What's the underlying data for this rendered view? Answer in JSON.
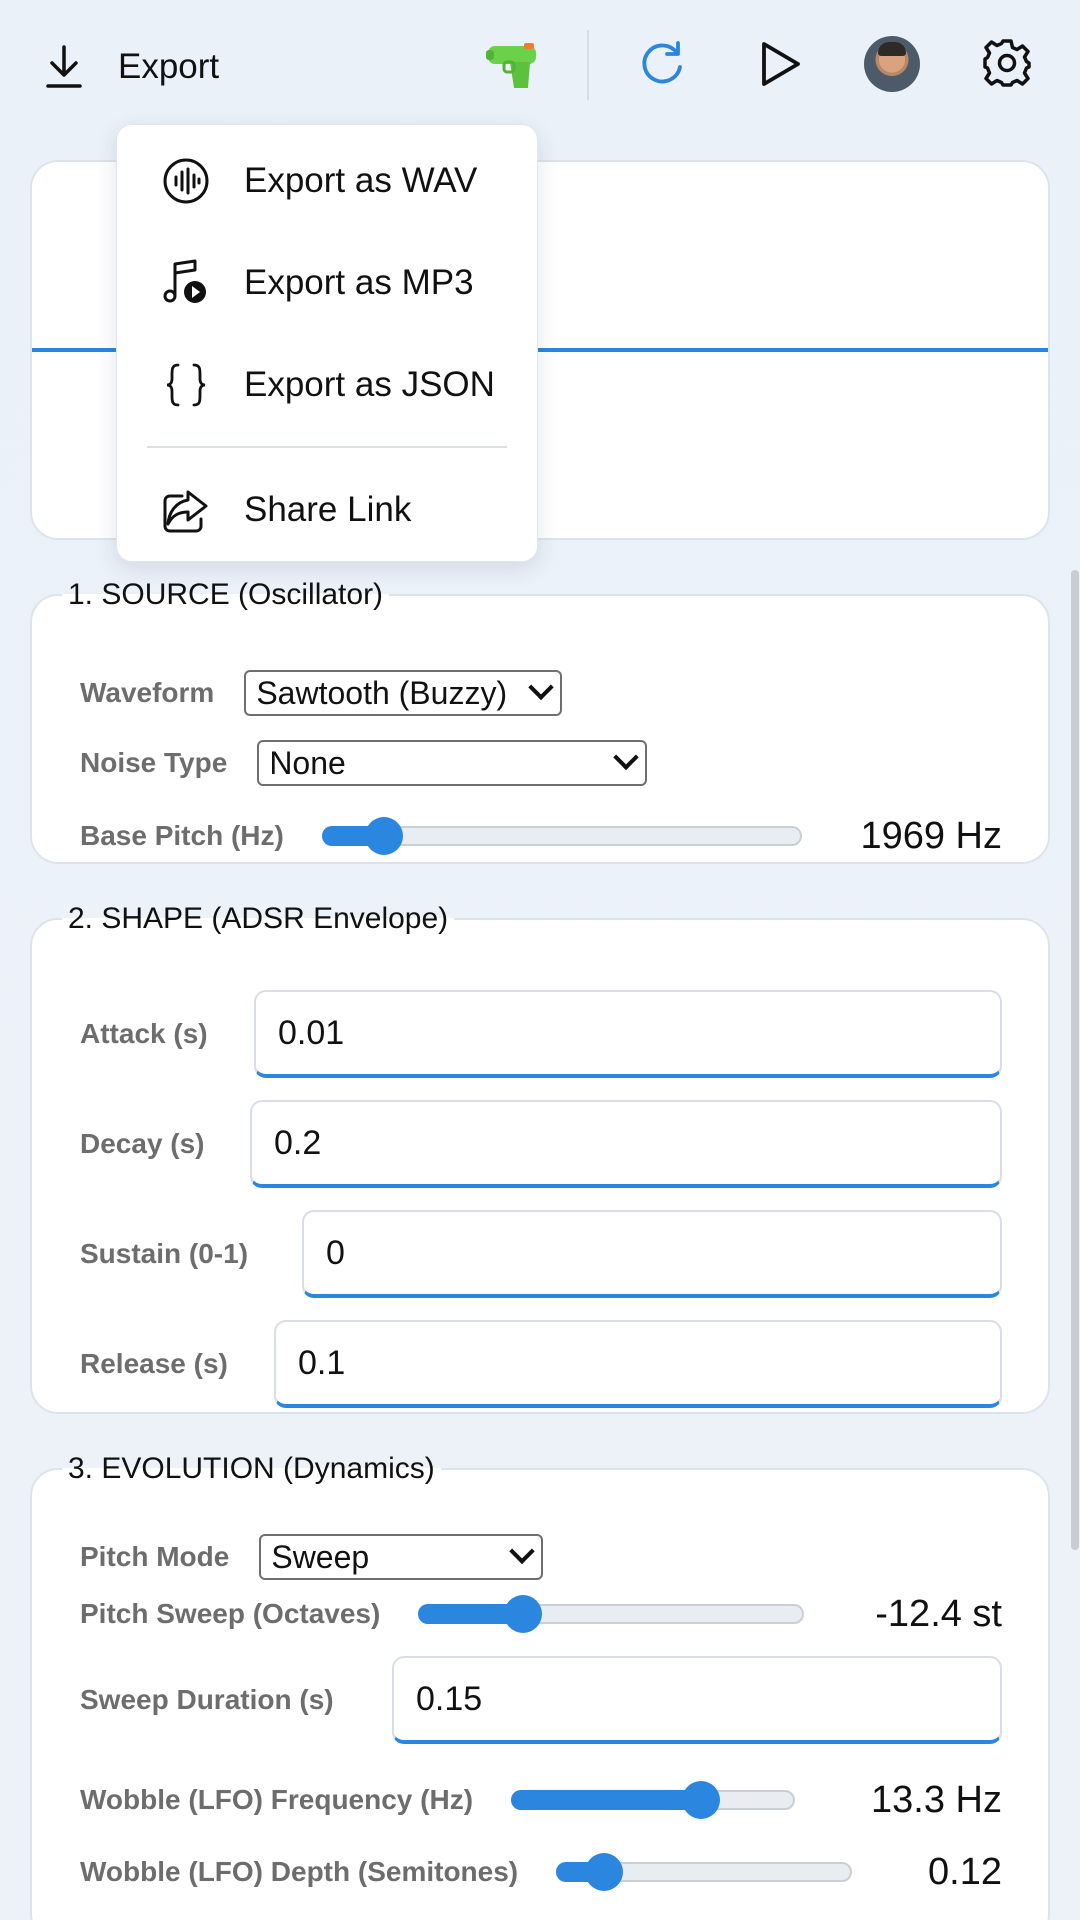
{
  "toolbar": {
    "export_label": "Export",
    "icons": [
      "download-icon",
      "water-gun-icon",
      "refresh-icon",
      "play-icon",
      "avatar",
      "gear-icon"
    ],
    "accent": "#2b86e0"
  },
  "export_menu": {
    "items": [
      {
        "label": "Export as WAV",
        "icon": "waveform-icon"
      },
      {
        "label": "Export as MP3",
        "icon": "music-note-icon"
      },
      {
        "label": "Export as JSON",
        "icon": "braces-icon"
      },
      {
        "label": "Share Link",
        "icon": "share-icon"
      }
    ]
  },
  "source": {
    "legend": "1. SOURCE (Oscillator)",
    "waveform": {
      "label": "Waveform",
      "value": "Sawtooth (Buzzy)"
    },
    "noise_type": {
      "label": "Noise Type",
      "value": "None"
    },
    "base_pitch": {
      "label": "Base Pitch (Hz)",
      "value": "1969 Hz",
      "fraction": 0.13
    }
  },
  "shape": {
    "legend": "2. SHAPE (ADSR Envelope)",
    "attack": {
      "label": "Attack (s)",
      "value": "0.01"
    },
    "decay": {
      "label": "Decay (s)",
      "value": "0.2"
    },
    "sustain": {
      "label": "Sustain (0-1)",
      "value": "0"
    },
    "release": {
      "label": "Release (s)",
      "value": "0.1"
    }
  },
  "evolution": {
    "legend": "3. EVOLUTION (Dynamics)",
    "pitch_mode": {
      "label": "Pitch Mode",
      "value": "Sweep"
    },
    "pitch_sweep": {
      "label": "Pitch Sweep (Octaves)",
      "value": "-12.4 st",
      "fraction": 0.27
    },
    "sweep_duration": {
      "label": "Sweep Duration (s)",
      "value": "0.15"
    },
    "lfo_frequency": {
      "label": "Wobble (LFO) Frequency (Hz)",
      "value": "13.3 Hz",
      "fraction": 0.67
    },
    "lfo_depth": {
      "label": "Wobble (LFO) Depth (Semitones)",
      "value": "0.12",
      "fraction": 0.16
    }
  }
}
